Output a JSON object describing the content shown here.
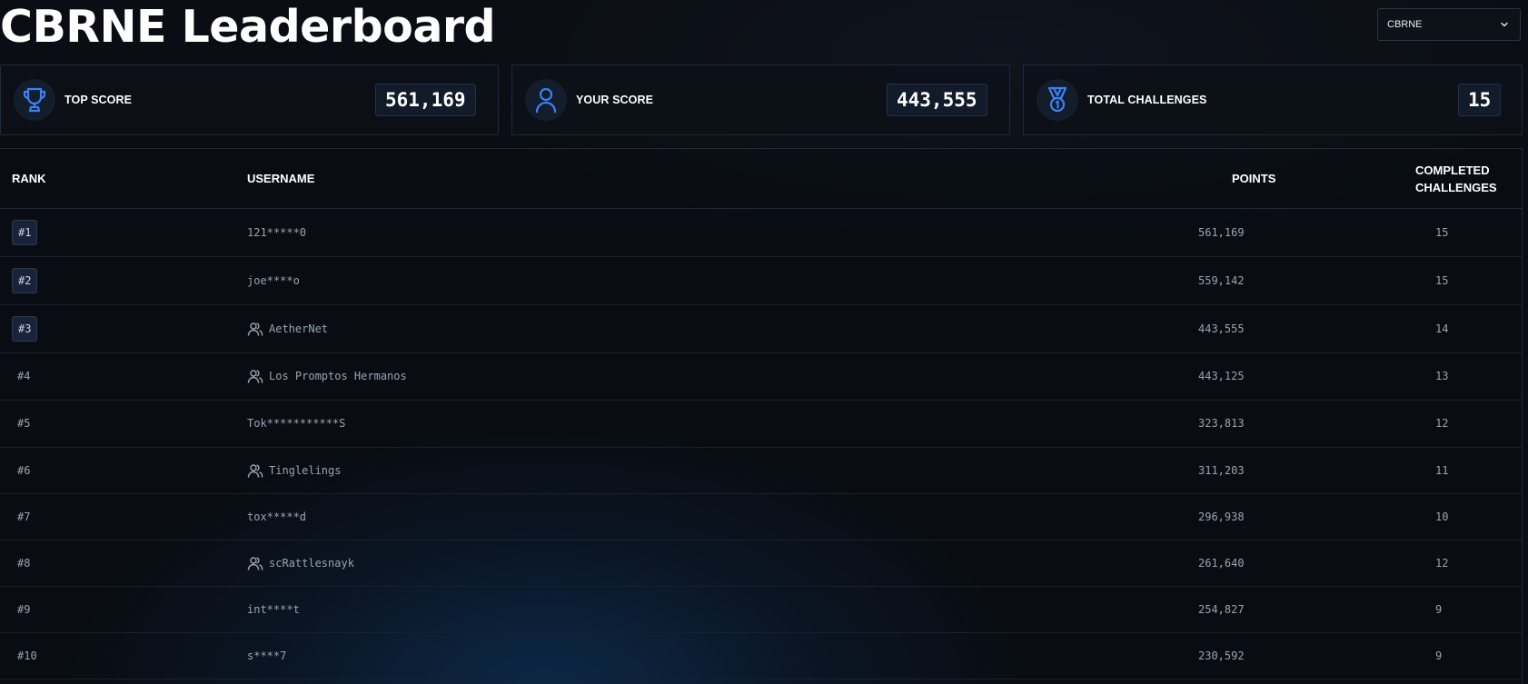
{
  "header": {
    "title": "CBRNE Leaderboard",
    "category_select": {
      "selected": "CBRNE",
      "icon": "chevron-down-icon"
    }
  },
  "stats": [
    {
      "label": "TOP SCORE",
      "value": "561,169",
      "icon": "trophy-icon"
    },
    {
      "label": "YOUR SCORE",
      "value": "443,555",
      "icon": "user-icon"
    },
    {
      "label": "TOTAL CHALLENGES",
      "value": "15",
      "icon": "medal-icon"
    }
  ],
  "table": {
    "headers": {
      "rank": "RANK",
      "username": "USERNAME",
      "points": "POINTS",
      "completed_line1": "COMPLETED",
      "completed_line2": "CHALLENGES"
    },
    "rows": [
      {
        "rank": "#1",
        "username": "121*****0",
        "team": false,
        "points": "561,169",
        "completed": "15"
      },
      {
        "rank": "#2",
        "username": "joe****o",
        "team": false,
        "points": "559,142",
        "completed": "15"
      },
      {
        "rank": "#3",
        "username": "AetherNet",
        "team": true,
        "points": "443,555",
        "completed": "14"
      },
      {
        "rank": "#4",
        "username": "Los Promptos Hermanos",
        "team": true,
        "points": "443,125",
        "completed": "13"
      },
      {
        "rank": "#5",
        "username": "Tok***********S",
        "team": false,
        "points": "323,813",
        "completed": "12"
      },
      {
        "rank": "#6",
        "username": "Tinglelings",
        "team": true,
        "points": "311,203",
        "completed": "11"
      },
      {
        "rank": "#7",
        "username": "tox*****d",
        "team": false,
        "points": "296,938",
        "completed": "10"
      },
      {
        "rank": "#8",
        "username": "scRattlesnayk",
        "team": true,
        "points": "261,640",
        "completed": "12"
      },
      {
        "rank": "#9",
        "username": "int****t",
        "team": false,
        "points": "254,827",
        "completed": "9"
      },
      {
        "rank": "#10",
        "username": "s****7",
        "team": false,
        "points": "230,592",
        "completed": "9"
      }
    ]
  },
  "colors": {
    "background": "#0a0d13",
    "accent_blue": "#3b82f6",
    "card_border": "#1f2a3b",
    "muted_text": "#9aa3b1"
  }
}
